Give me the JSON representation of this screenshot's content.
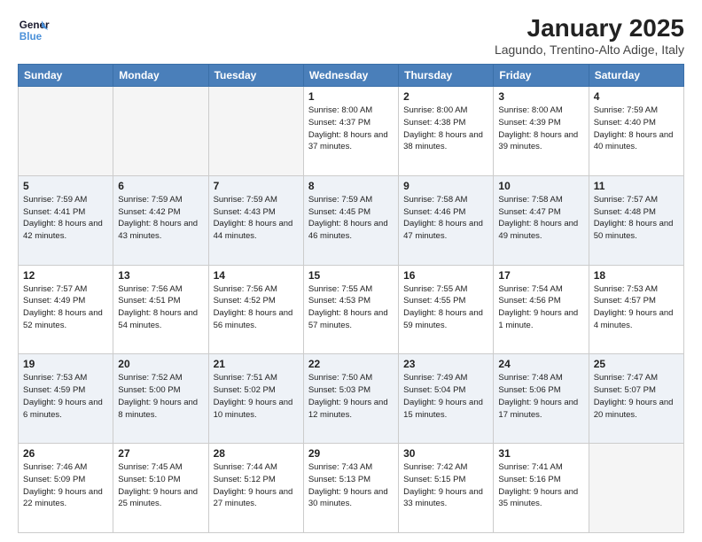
{
  "header": {
    "logo_line1": "General",
    "logo_line2": "Blue",
    "month": "January 2025",
    "location": "Lagundo, Trentino-Alto Adige, Italy"
  },
  "weekdays": [
    "Sunday",
    "Monday",
    "Tuesday",
    "Wednesday",
    "Thursday",
    "Friday",
    "Saturday"
  ],
  "weeks": [
    [
      {
        "day": "",
        "info": "",
        "empty": true
      },
      {
        "day": "",
        "info": "",
        "empty": true
      },
      {
        "day": "",
        "info": "",
        "empty": true
      },
      {
        "day": "1",
        "info": "Sunrise: 8:00 AM\nSunset: 4:37 PM\nDaylight: 8 hours\nand 37 minutes."
      },
      {
        "day": "2",
        "info": "Sunrise: 8:00 AM\nSunset: 4:38 PM\nDaylight: 8 hours\nand 38 minutes."
      },
      {
        "day": "3",
        "info": "Sunrise: 8:00 AM\nSunset: 4:39 PM\nDaylight: 8 hours\nand 39 minutes."
      },
      {
        "day": "4",
        "info": "Sunrise: 7:59 AM\nSunset: 4:40 PM\nDaylight: 8 hours\nand 40 minutes."
      }
    ],
    [
      {
        "day": "5",
        "info": "Sunrise: 7:59 AM\nSunset: 4:41 PM\nDaylight: 8 hours\nand 42 minutes."
      },
      {
        "day": "6",
        "info": "Sunrise: 7:59 AM\nSunset: 4:42 PM\nDaylight: 8 hours\nand 43 minutes."
      },
      {
        "day": "7",
        "info": "Sunrise: 7:59 AM\nSunset: 4:43 PM\nDaylight: 8 hours\nand 44 minutes."
      },
      {
        "day": "8",
        "info": "Sunrise: 7:59 AM\nSunset: 4:45 PM\nDaylight: 8 hours\nand 46 minutes."
      },
      {
        "day": "9",
        "info": "Sunrise: 7:58 AM\nSunset: 4:46 PM\nDaylight: 8 hours\nand 47 minutes."
      },
      {
        "day": "10",
        "info": "Sunrise: 7:58 AM\nSunset: 4:47 PM\nDaylight: 8 hours\nand 49 minutes."
      },
      {
        "day": "11",
        "info": "Sunrise: 7:57 AM\nSunset: 4:48 PM\nDaylight: 8 hours\nand 50 minutes."
      }
    ],
    [
      {
        "day": "12",
        "info": "Sunrise: 7:57 AM\nSunset: 4:49 PM\nDaylight: 8 hours\nand 52 minutes."
      },
      {
        "day": "13",
        "info": "Sunrise: 7:56 AM\nSunset: 4:51 PM\nDaylight: 8 hours\nand 54 minutes."
      },
      {
        "day": "14",
        "info": "Sunrise: 7:56 AM\nSunset: 4:52 PM\nDaylight: 8 hours\nand 56 minutes."
      },
      {
        "day": "15",
        "info": "Sunrise: 7:55 AM\nSunset: 4:53 PM\nDaylight: 8 hours\nand 57 minutes."
      },
      {
        "day": "16",
        "info": "Sunrise: 7:55 AM\nSunset: 4:55 PM\nDaylight: 8 hours\nand 59 minutes."
      },
      {
        "day": "17",
        "info": "Sunrise: 7:54 AM\nSunset: 4:56 PM\nDaylight: 9 hours\nand 1 minute."
      },
      {
        "day": "18",
        "info": "Sunrise: 7:53 AM\nSunset: 4:57 PM\nDaylight: 9 hours\nand 4 minutes."
      }
    ],
    [
      {
        "day": "19",
        "info": "Sunrise: 7:53 AM\nSunset: 4:59 PM\nDaylight: 9 hours\nand 6 minutes."
      },
      {
        "day": "20",
        "info": "Sunrise: 7:52 AM\nSunset: 5:00 PM\nDaylight: 9 hours\nand 8 minutes."
      },
      {
        "day": "21",
        "info": "Sunrise: 7:51 AM\nSunset: 5:02 PM\nDaylight: 9 hours\nand 10 minutes."
      },
      {
        "day": "22",
        "info": "Sunrise: 7:50 AM\nSunset: 5:03 PM\nDaylight: 9 hours\nand 12 minutes."
      },
      {
        "day": "23",
        "info": "Sunrise: 7:49 AM\nSunset: 5:04 PM\nDaylight: 9 hours\nand 15 minutes."
      },
      {
        "day": "24",
        "info": "Sunrise: 7:48 AM\nSunset: 5:06 PM\nDaylight: 9 hours\nand 17 minutes."
      },
      {
        "day": "25",
        "info": "Sunrise: 7:47 AM\nSunset: 5:07 PM\nDaylight: 9 hours\nand 20 minutes."
      }
    ],
    [
      {
        "day": "26",
        "info": "Sunrise: 7:46 AM\nSunset: 5:09 PM\nDaylight: 9 hours\nand 22 minutes."
      },
      {
        "day": "27",
        "info": "Sunrise: 7:45 AM\nSunset: 5:10 PM\nDaylight: 9 hours\nand 25 minutes."
      },
      {
        "day": "28",
        "info": "Sunrise: 7:44 AM\nSunset: 5:12 PM\nDaylight: 9 hours\nand 27 minutes."
      },
      {
        "day": "29",
        "info": "Sunrise: 7:43 AM\nSunset: 5:13 PM\nDaylight: 9 hours\nand 30 minutes."
      },
      {
        "day": "30",
        "info": "Sunrise: 7:42 AM\nSunset: 5:15 PM\nDaylight: 9 hours\nand 33 minutes."
      },
      {
        "day": "31",
        "info": "Sunrise: 7:41 AM\nSunset: 5:16 PM\nDaylight: 9 hours\nand 35 minutes."
      },
      {
        "day": "",
        "info": "",
        "empty": true
      }
    ]
  ]
}
